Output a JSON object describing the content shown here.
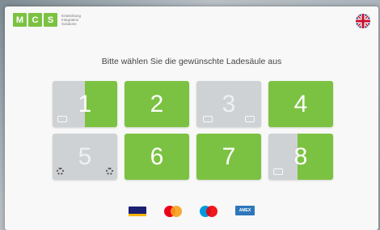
{
  "header": {
    "logo_letters": [
      "M",
      "C",
      "S"
    ],
    "logo_sub": [
      "Entwicklung",
      "Integration",
      "Solutions"
    ],
    "language_flag": "uk-flag-icon"
  },
  "main": {
    "title": "Bitte wählen Sie die gewünschte Ladesäule aus",
    "stations": [
      {
        "label": "1",
        "state": "partial",
        "fill_fraction": 0.5
      },
      {
        "label": "2",
        "state": "available"
      },
      {
        "label": "3",
        "state": "unavailable"
      },
      {
        "label": "4",
        "state": "available"
      },
      {
        "label": "5",
        "state": "out-of-service"
      },
      {
        "label": "6",
        "state": "available"
      },
      {
        "label": "7",
        "state": "available"
      },
      {
        "label": "8",
        "state": "partial",
        "fill_fraction": 0.55
      }
    ]
  },
  "footer": {
    "payment_methods": [
      "visa-vpay-icon",
      "mastercard-icon",
      "maestro-icon",
      "amex-icon"
    ],
    "amex_label": "AMEX"
  },
  "colors": {
    "accent_green": "#7cc242",
    "inactive_gray": "#cfd2d4",
    "background": "#f7f8f7"
  }
}
